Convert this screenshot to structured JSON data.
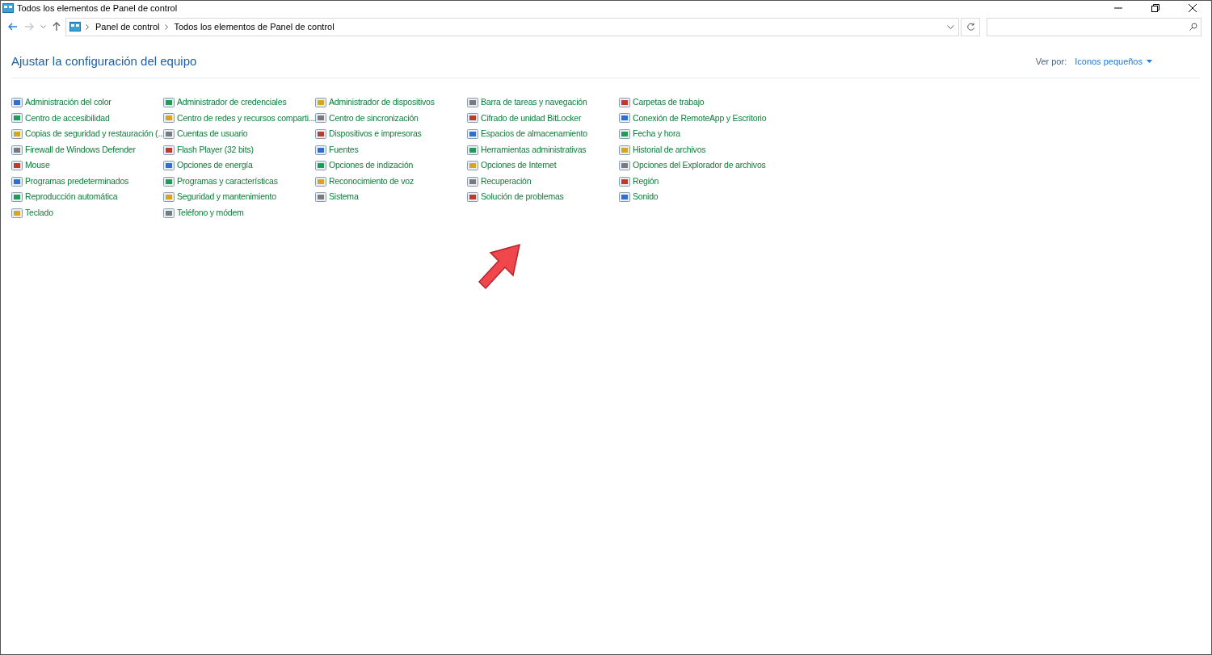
{
  "window": {
    "title": "Todos los elementos de Panel de control"
  },
  "address_bar": {
    "breadcrumbs": [
      "Panel de control",
      "Todos los elementos de Panel de control"
    ]
  },
  "heading": "Ajustar la configuración del equipo",
  "view_by": {
    "label": "Ver por:",
    "value": "Iconos pequeños"
  },
  "columns": [
    [
      "Administración del color",
      "Centro de accesibilidad",
      "Copias de seguridad y restauración (...",
      "Firewall de Windows Defender",
      "Mouse",
      "Programas predeterminados",
      "Reproducción automática",
      "Teclado"
    ],
    [
      "Administrador de credenciales",
      "Centro de redes y recursos comparti...",
      "Cuentas de usuario",
      "Flash Player (32 bits)",
      "Opciones de energía",
      "Programas y características",
      "Seguridad y mantenimiento",
      "Teléfono y módem"
    ],
    [
      "Administrador de dispositivos",
      "Centro de sincronización",
      "Dispositivos e impresoras",
      "Fuentes",
      "Opciones de indización",
      "Reconocimiento de voz",
      "Sistema"
    ],
    [
      "Barra de tareas y navegación",
      "Cifrado de unidad BitLocker",
      "Espacios de almacenamiento",
      "Herramientas administrativas",
      "Opciones de Internet",
      "Recuperación",
      "Solución de problemas"
    ],
    [
      "Carpetas de trabajo",
      "Conexión de RemoteApp y Escritorio",
      "Fecha y hora",
      "Historial de archivos",
      "Opciones del Explorador de archivos",
      "Región",
      "Sonido"
    ]
  ]
}
